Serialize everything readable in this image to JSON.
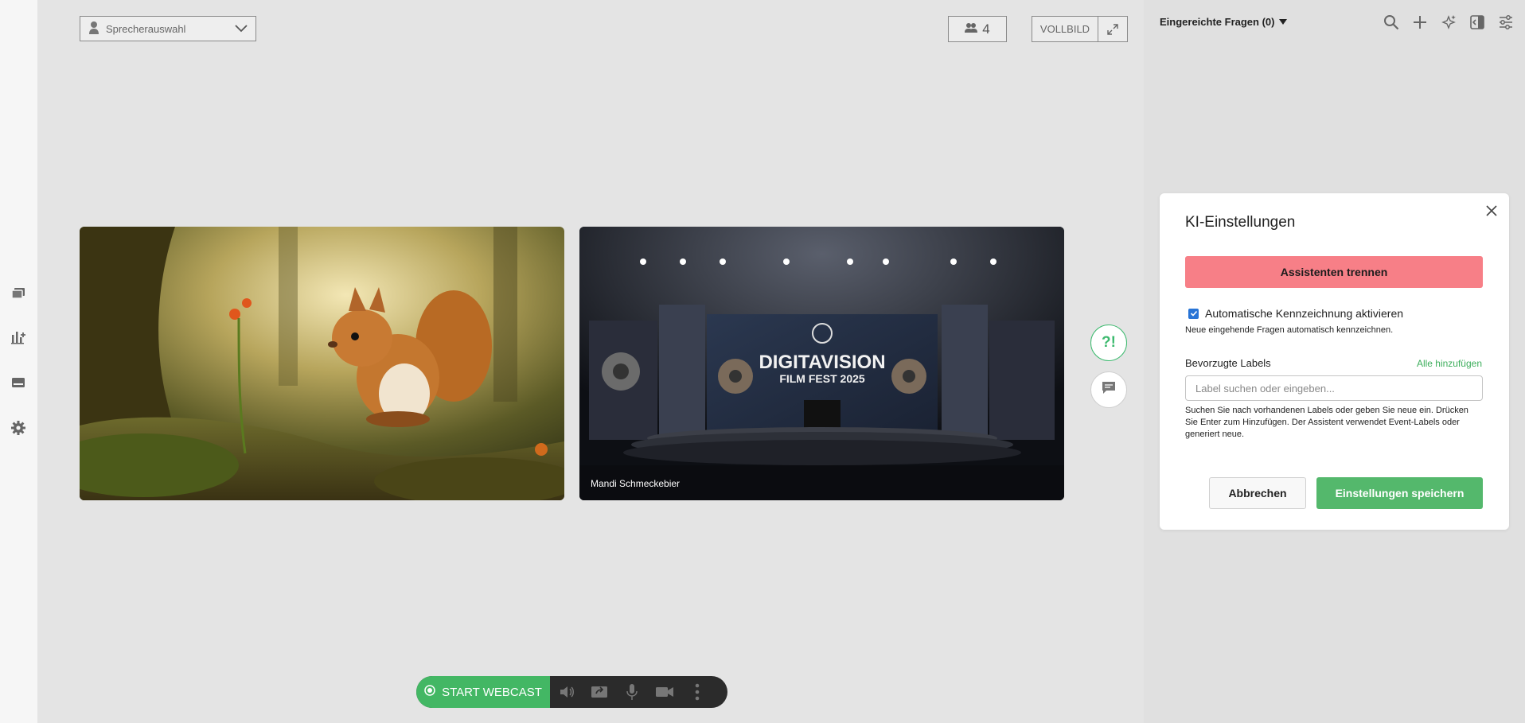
{
  "stage": {
    "speaker_select": "Sprecherauswahl",
    "participant_count": "4",
    "fullscreen_label": "VOLLBILD",
    "tile2_speaker": "Mandi Schmeckebier",
    "tile2_banner_title": "DIGITAVISION",
    "tile2_banner_subtitle": "FILM FEST 2025",
    "qa_button_label": "?!"
  },
  "toolbar": {
    "start_label": "START WEBCAST"
  },
  "panel": {
    "heading": "Eingereichte Fragen (0)"
  },
  "dialog": {
    "title": "KI-Einstellungen",
    "disconnect_label": "Assistenten trennen",
    "auto_label": "Automatische Kennzeichnung aktivieren",
    "auto_desc": "Neue eingehende Fragen automatisch kennzeichnen.",
    "labels_title": "Bevorzugte Labels",
    "add_all": "Alle hinzufügen",
    "input_placeholder": "Label suchen oder eingeben...",
    "help_text": "Suchen Sie nach vorhandenen Labels oder geben Sie neue ein. Drücken Sie Enter zum Hinzufügen. Der Assistent verwendet Event-Labels oder generiert neue.",
    "cancel_label": "Abbrechen",
    "save_label": "Einstellungen speichern"
  },
  "colors": {
    "accent_green": "#43b764",
    "danger": "#f77f87",
    "checkbox_blue": "#2874d6"
  }
}
